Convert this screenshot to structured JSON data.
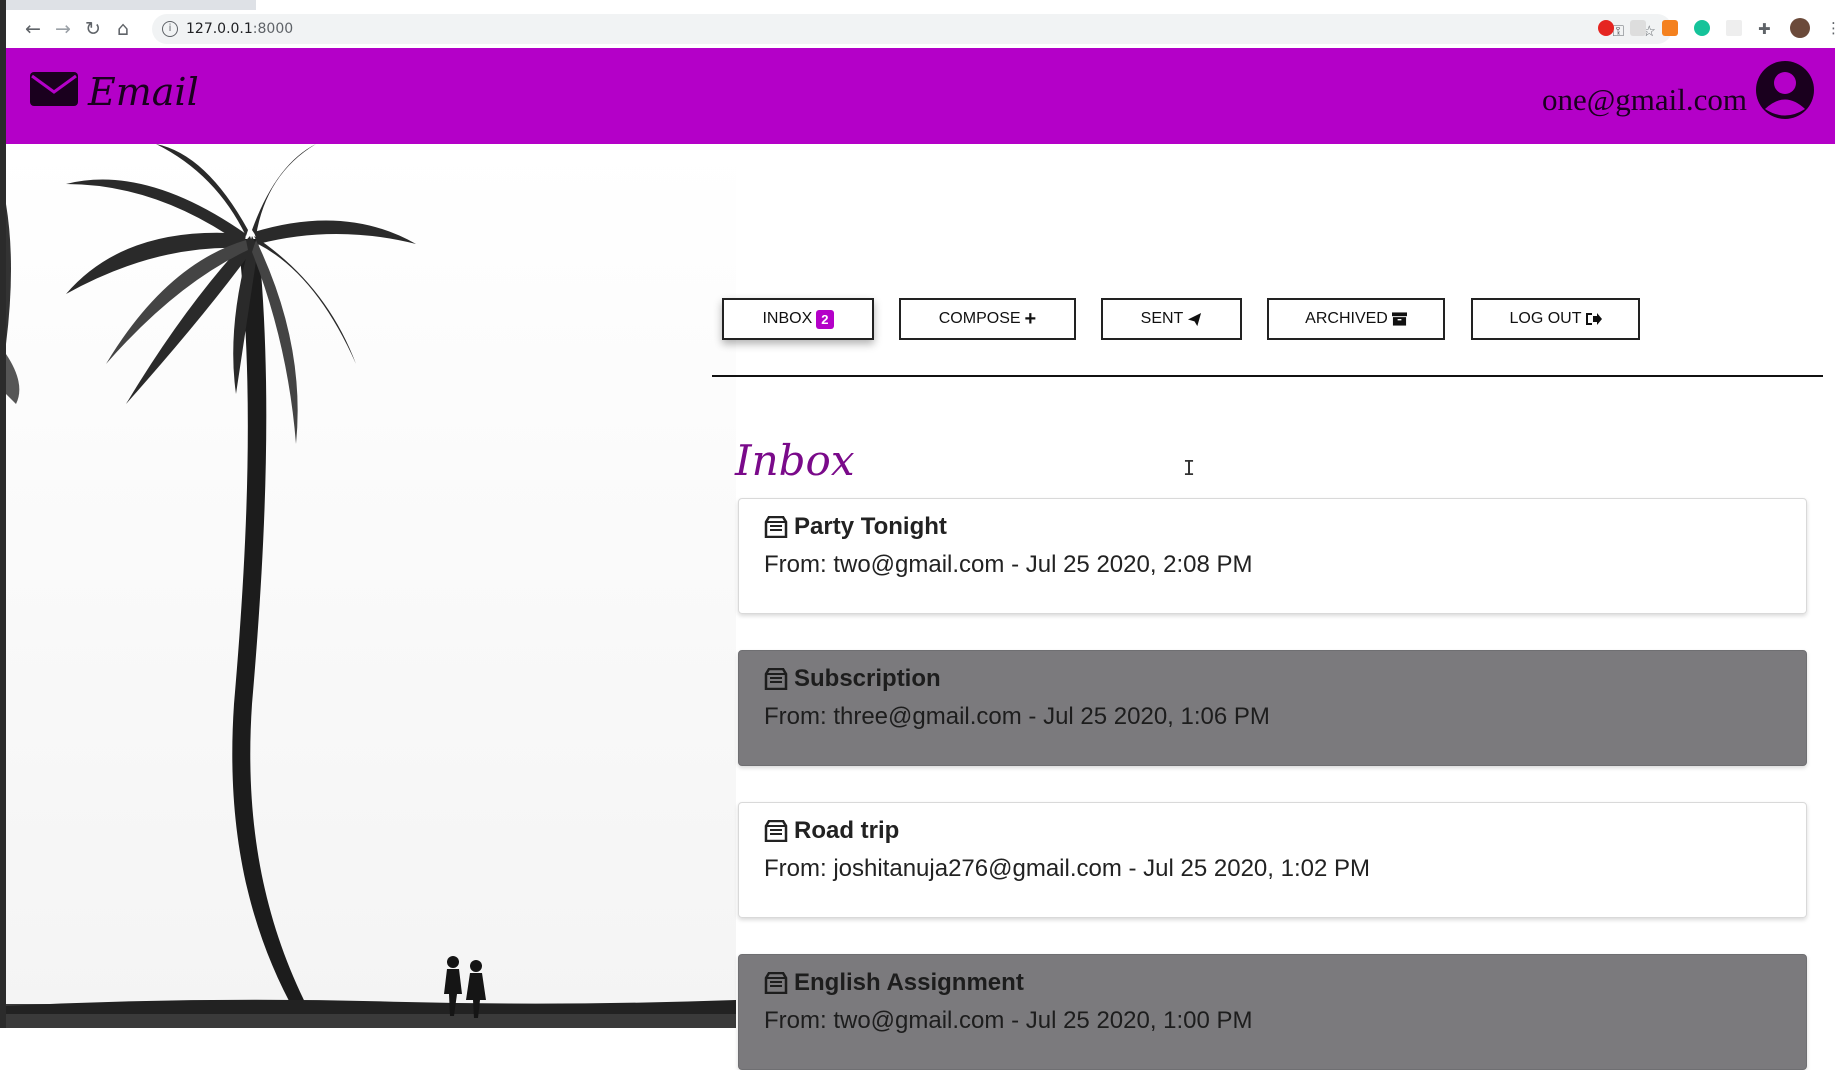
{
  "browser": {
    "url_host": "127.0.0.1",
    "url_port": ":8000",
    "icons": [
      "back-icon",
      "forward-icon",
      "reload-icon",
      "home-icon",
      "key-icon",
      "star-icon",
      "puzzle-icon"
    ]
  },
  "header": {
    "brand": "Email",
    "user_email": "one@gmail.com",
    "colors": {
      "header_bg": "#b400c8",
      "accent": "#7a0a8a"
    }
  },
  "nav": {
    "inbox_label": "INBOX",
    "inbox_count": "2",
    "compose_label": "COMPOSE",
    "sent_label": "SENT",
    "archived_label": "ARCHIVED",
    "logout_label": "LOG OUT"
  },
  "main": {
    "title": "Inbox",
    "emails": [
      {
        "subject": "Party Tonight",
        "meta": "From: two@gmail.com - Jul 25 2020, 2:08 PM",
        "read": false
      },
      {
        "subject": "Subscription",
        "meta": "From: three@gmail.com - Jul 25 2020, 1:06 PM",
        "read": true
      },
      {
        "subject": "Road trip",
        "meta": "From: joshitanuja276@gmail.com - Jul 25 2020, 1:02 PM",
        "read": false
      },
      {
        "subject": "English Assignment",
        "meta": "From: two@gmail.com - Jul 25 2020, 1:00 PM",
        "read": true
      }
    ]
  }
}
